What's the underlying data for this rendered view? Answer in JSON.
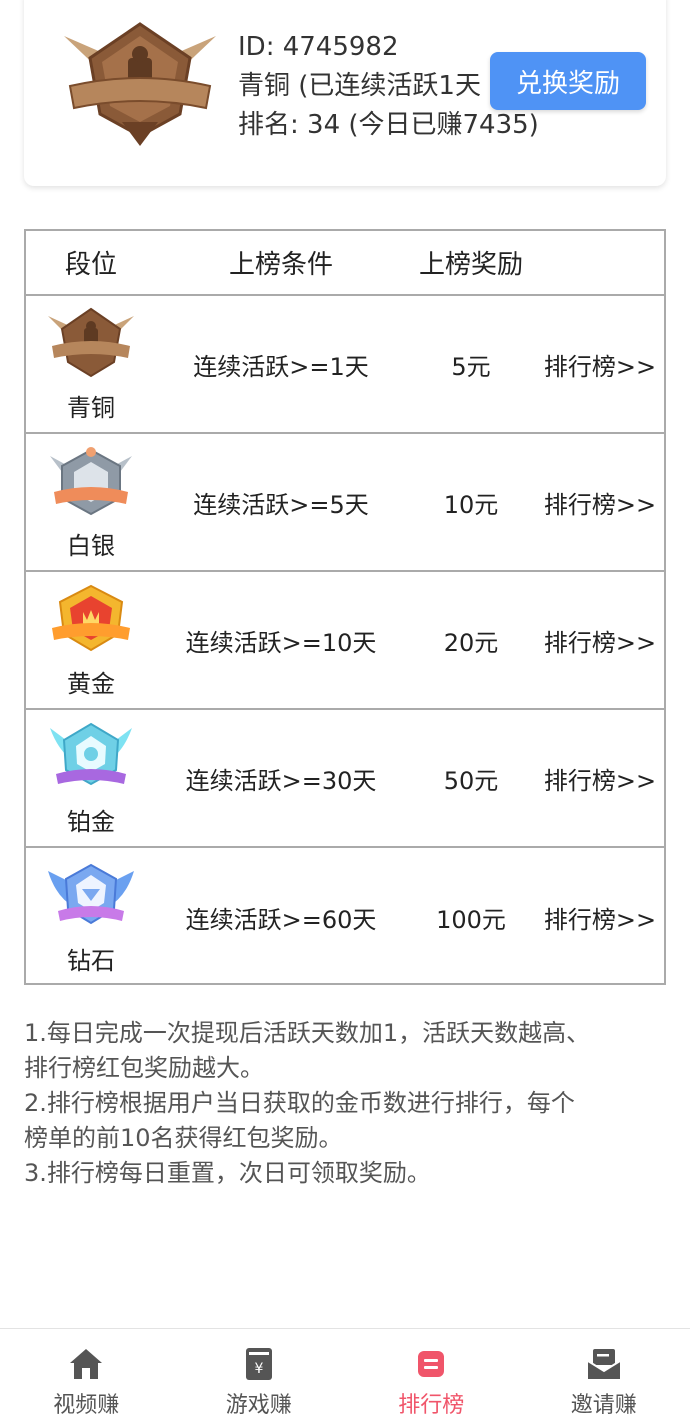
{
  "profile": {
    "badge_icon": "bronze-badge-icon",
    "id_line": "ID: 4745982",
    "status_line": "青铜  (已连续活跃1天",
    "rank_line": "排名: 34 (今日已赚7435)",
    "exchange_button": "兑换奖励"
  },
  "table": {
    "headers": [
      "段位",
      "上榜条件",
      "上榜奖励"
    ],
    "rows": [
      {
        "tier": "青铜",
        "icon": "bronze-badge-icon",
        "condition": "连续活跃>=1天",
        "reward": "5元",
        "link": "排行榜>>"
      },
      {
        "tier": "白银",
        "icon": "silver-badge-icon",
        "condition": "连续活跃>=5天",
        "reward": "10元",
        "link": "排行榜>>"
      },
      {
        "tier": "黄金",
        "icon": "gold-badge-icon",
        "condition": "连续活跃>=10天",
        "reward": "20元",
        "link": "排行榜>>"
      },
      {
        "tier": "铂金",
        "icon": "platinum-badge-icon",
        "condition": "连续活跃>=30天",
        "reward": "50元",
        "link": "排行榜>>"
      },
      {
        "tier": "钻石",
        "icon": "diamond-badge-icon",
        "condition": "连续活跃>=60天",
        "reward": "100元",
        "link": "排行榜>>"
      }
    ]
  },
  "rules": [
    "1.每日完成一次提现后活跃天数加1，活跃天数越高、",
    "排行榜红包奖励越大。",
    "2.排行榜根据用户当日获取的金币数进行排行，每个",
    "榜单的前10名获得红包奖励。",
    "3.排行榜每日重置，次日可领取奖励。"
  ],
  "nav": {
    "active_color": "#f0556a",
    "items": [
      {
        "label": "视频赚",
        "icon": "home-icon",
        "active": false
      },
      {
        "label": "游戏赚",
        "icon": "game-coupon-icon",
        "active": false
      },
      {
        "label": "排行榜",
        "icon": "leaderboard-icon",
        "active": true
      },
      {
        "label": "邀请赚",
        "icon": "invite-mail-icon",
        "active": false
      }
    ]
  },
  "colors": {
    "accent_button": "#4f93f5",
    "table_border": "#aaaaaa",
    "bronze": "#9b6a45",
    "silver": "#8f9aa6",
    "gold": "#f4b62e",
    "platinum": "#6fd0e6",
    "diamond": "#7aa8f0"
  }
}
